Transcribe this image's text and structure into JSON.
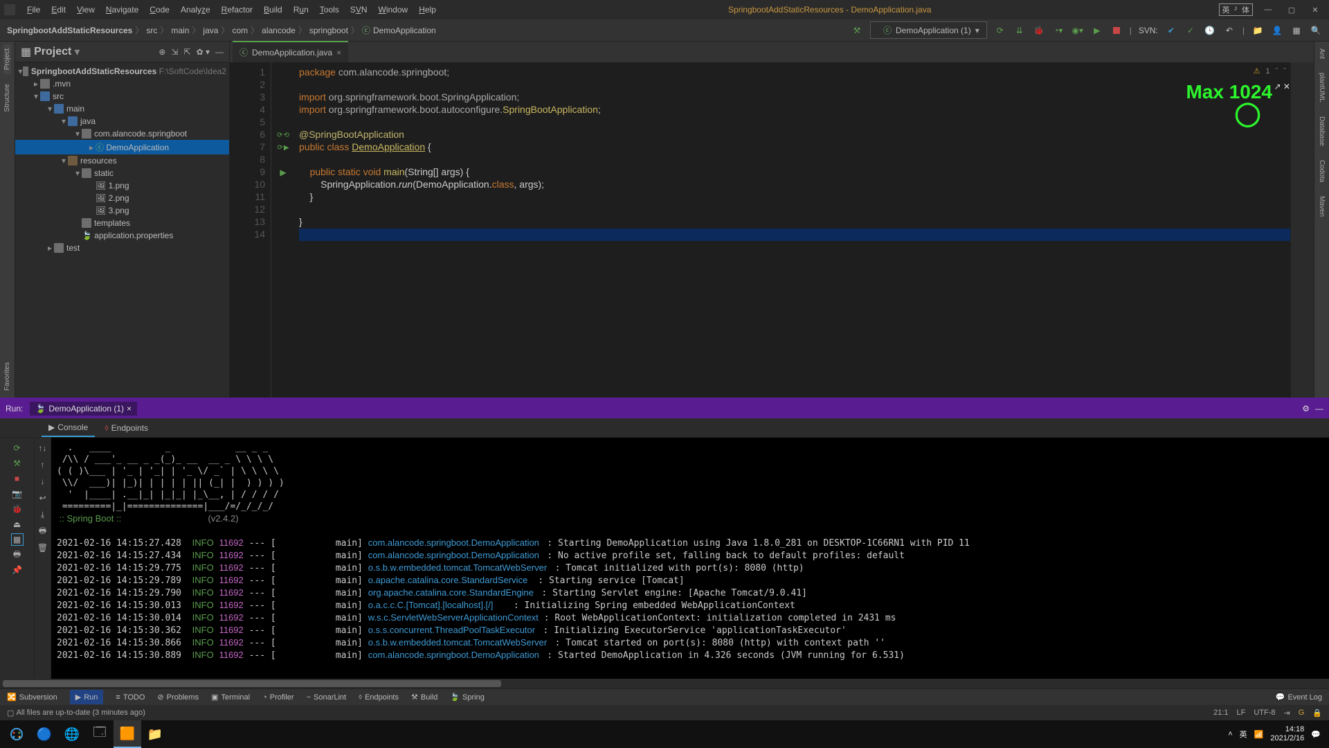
{
  "title": "SpringbootAddStaticResources - DemoApplication.java",
  "menu": [
    "File",
    "Edit",
    "View",
    "Navigate",
    "Code",
    "Analyze",
    "Refactor",
    "Build",
    "Run",
    "Tools",
    "SVN",
    "Window",
    "Help"
  ],
  "ime": "英",
  "crumbs": [
    "SpringbootAddStaticResources",
    "src",
    "main",
    "java",
    "com",
    "alancode",
    "springboot",
    "DemoApplication"
  ],
  "runConfig": "DemoApplication (1)",
  "svnLabel": "SVN:",
  "projectTool": {
    "title": "Project"
  },
  "tree": {
    "root": "SpringbootAddStaticResources",
    "rootPath": "F:\\SoftCode\\Idea2",
    "mvn": ".mvn",
    "src": "src",
    "main": "main",
    "java": "java",
    "pkg": "com.alancode.springboot",
    "cls": "DemoApplication",
    "res": "resources",
    "static": "static",
    "f1": "1.png",
    "f2": "2.png",
    "f3": "3.png",
    "templates": "templates",
    "appprops": "application.properties",
    "test": "test"
  },
  "editorTab": "DemoApplication.java",
  "code": {
    "l1": "package com.alancode.springboot;",
    "l3a": "import ",
    "l3b": "org.springframework.boot.SpringApplication;",
    "l4a": "import ",
    "l4b": "org.springframework.boot.autoconfigure.",
    "l4c": "SpringBootApplication",
    "l6": "@SpringBootApplication",
    "l7a": "public class ",
    "l7b": "DemoApplication",
    " l7c": " {",
    "l9a": "    public static void ",
    "l9b": "main",
    "l9c": "(String[] args) {",
    "l10a": "        SpringApplication.",
    "l10b": "run",
    "l10c": "(DemoApplication.",
    "l10d": "class",
    "l10e": ", args);",
    "l11": "    }",
    "l13": "}"
  },
  "lineCount": 14,
  "notice": "1",
  "maxlogo": "Max 1024",
  "run": {
    "title": "Run:",
    "cfg": "DemoApplication (1)",
    "tabs": [
      "Console",
      "Endpoints"
    ],
    "springArt": [
      "  .   ____          _            __ _ _",
      " /\\\\ / ___'_ __ _ _(_)_ __  __ _ \\ \\ \\ \\",
      "( ( )\\___ | '_ | '_| | '_ \\/ _` | \\ \\ \\ \\",
      " \\\\/  ___)| |_)| | | | | || (_| |  ) ) ) )",
      "  '  |____| .__|_| |_|_| |_\\__, | / / / /",
      " =========|_|==============|___/=/_/_/_/"
    ],
    "springBoot": " :: Spring Boot ::",
    "springVer": "(v2.4.2)",
    "logs": [
      {
        "ts": "2021-02-16 14:15:27.428",
        "lvl": "INFO",
        "pid": "11692",
        "t": "main",
        "src": "com.alancode.springboot.DemoApplication",
        "msg": "Starting DemoApplication using Java 1.8.0_281 on DESKTOP-1C66RN1 with PID 11"
      },
      {
        "ts": "2021-02-16 14:15:27.434",
        "lvl": "INFO",
        "pid": "11692",
        "t": "main",
        "src": "com.alancode.springboot.DemoApplication",
        "msg": "No active profile set, falling back to default profiles: default"
      },
      {
        "ts": "2021-02-16 14:15:29.775",
        "lvl": "INFO",
        "pid": "11692",
        "t": "main",
        "src": "o.s.b.w.embedded.tomcat.TomcatWebServer",
        "msg": "Tomcat initialized with port(s): 8080 (http)"
      },
      {
        "ts": "2021-02-16 14:15:29.789",
        "lvl": "INFO",
        "pid": "11692",
        "t": "main",
        "src": "o.apache.catalina.core.StandardService",
        "msg": "Starting service [Tomcat]"
      },
      {
        "ts": "2021-02-16 14:15:29.790",
        "lvl": "INFO",
        "pid": "11692",
        "t": "main",
        "src": "org.apache.catalina.core.StandardEngine",
        "msg": "Starting Servlet engine: [Apache Tomcat/9.0.41]"
      },
      {
        "ts": "2021-02-16 14:15:30.013",
        "lvl": "INFO",
        "pid": "11692",
        "t": "main",
        "src": "o.a.c.c.C.[Tomcat].[localhost].[/]",
        "msg": "Initializing Spring embedded WebApplicationContext"
      },
      {
        "ts": "2021-02-16 14:15:30.014",
        "lvl": "INFO",
        "pid": "11692",
        "t": "main",
        "src": "w.s.c.ServletWebServerApplicationContext",
        "msg": "Root WebApplicationContext: initialization completed in 2431 ms"
      },
      {
        "ts": "2021-02-16 14:15:30.362",
        "lvl": "INFO",
        "pid": "11692",
        "t": "main",
        "src": "o.s.s.concurrent.ThreadPoolTaskExecutor",
        "msg": "Initializing ExecutorService 'applicationTaskExecutor'"
      },
      {
        "ts": "2021-02-16 14:15:30.866",
        "lvl": "INFO",
        "pid": "11692",
        "t": "main",
        "src": "o.s.b.w.embedded.tomcat.TomcatWebServer",
        "msg": "Tomcat started on port(s): 8080 (http) with context path ''"
      },
      {
        "ts": "2021-02-16 14:15:30.889",
        "lvl": "INFO",
        "pid": "11692",
        "t": "main",
        "src": "com.alancode.springboot.DemoApplication",
        "msg": "Started DemoApplication in 4.326 seconds (JVM running for 6.531)"
      }
    ]
  },
  "bottom": [
    "Subversion",
    "Run",
    "TODO",
    "Problems",
    "Terminal",
    "Profiler",
    "SonarLint",
    "Endpoints",
    "Build",
    "Spring"
  ],
  "eventlog": "Event Log",
  "status": "All files are up-to-date (3 minutes ago)",
  "statusRight": {
    "pos": "21:1",
    "lf": "LF",
    "enc": "UTF-8",
    "ime": "英"
  },
  "clock": {
    "t": "14:18",
    "d": "2021/2/16"
  },
  "leftTabs": [
    "Project",
    "Structure"
  ],
  "rightTabs": [
    "Ant",
    "plantUML",
    "Database",
    "Codota",
    "Maven"
  ],
  "favLabel": "Favorites"
}
